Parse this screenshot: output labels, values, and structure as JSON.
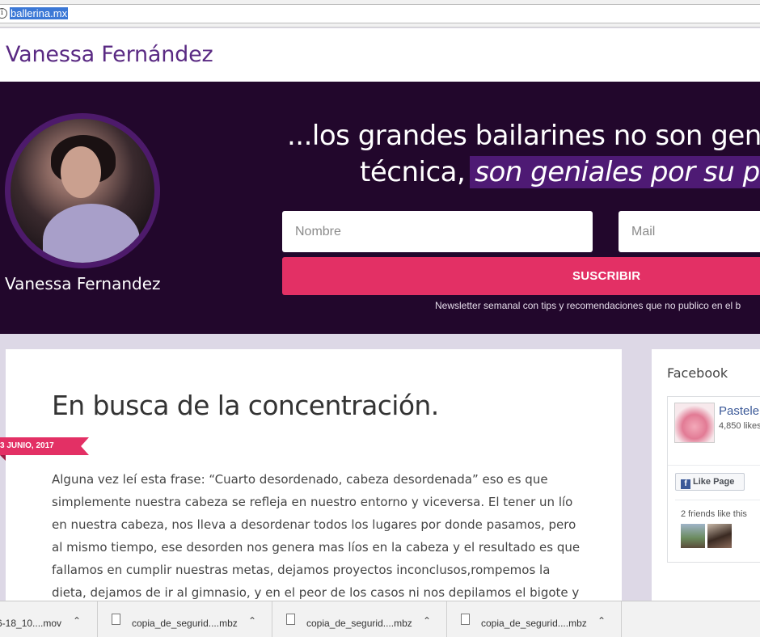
{
  "browser": {
    "url": "ballerina.mx"
  },
  "header": {
    "site_title": "Vanessa Fernández"
  },
  "hero": {
    "name": "Vanessa Fernandez",
    "quote_line1": "...los grandes bailarines no son gen",
    "quote_line2_plain": "técnica,",
    "quote_line2_highlight": "son geniales por su p",
    "name_placeholder": "Nombre",
    "mail_placeholder": "Mail",
    "subscribe_label": "SUSCRIBIR",
    "note": "Newsletter semanal con tips y recomendaciones que no publico en el b"
  },
  "post": {
    "title": "En busca de la concentración.",
    "date": "3 JUNIO, 2017",
    "body": "Alguna vez leí esta frase: “Cuarto desordenado, cabeza desordenada” eso es que simplemente nuestra cabeza se refleja en nuestro entorno y viceversa. El tener un lío en nuestra cabeza, nos lleva a desordenar todos los lugares por donde pasamos, pero al mismo tiempo, ese desorden nos genera mas líos en la cabeza y  el resultado es que fallamos en cumplir nuestras metas, dejamos proyectos inconclusos,rompemos la dieta, dejamos de ir al gimnasio, y en el peor de los casos ni nos depilamos el bigote y mucho"
  },
  "sidebar": {
    "title": "Facebook",
    "fb_page_name": "Pastele",
    "fb_likes": "4,850 likes",
    "like_label": "Like Page",
    "friends_text": "2 friends like this"
  },
  "downloads": [
    {
      "name": "6-18_10....mov"
    },
    {
      "name": "copia_de_segurid....mbz"
    },
    {
      "name": "copia_de_segurid....mbz"
    },
    {
      "name": "copia_de_segurid....mbz"
    }
  ]
}
